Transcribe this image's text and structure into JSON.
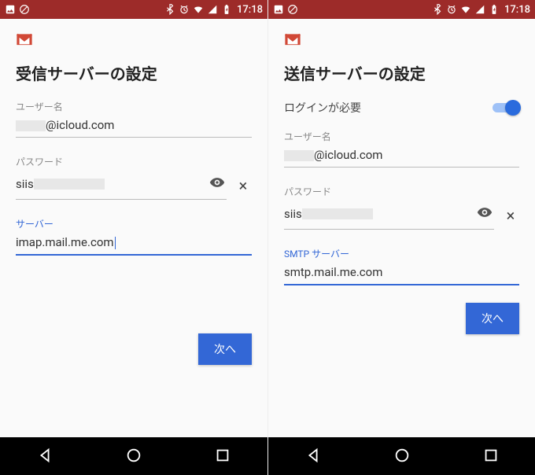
{
  "status": {
    "time": "17:18"
  },
  "left": {
    "title": "受信サーバーの設定",
    "username_label": "ユーザー名",
    "username_value": "@icloud.com",
    "password_label": "パスワード",
    "password_value": "siis",
    "server_label": "サーバー",
    "server_value": "imap.mail.me.com",
    "next": "次へ"
  },
  "right": {
    "title": "送信サーバーの設定",
    "login_required": "ログインが必要",
    "username_label": "ユーザー名",
    "username_value": "@icloud.com",
    "password_label": "パスワード",
    "password_value": "siis",
    "server_label": "SMTP サーバー",
    "server_value": "smtp.mail.me.com",
    "next": "次へ"
  }
}
